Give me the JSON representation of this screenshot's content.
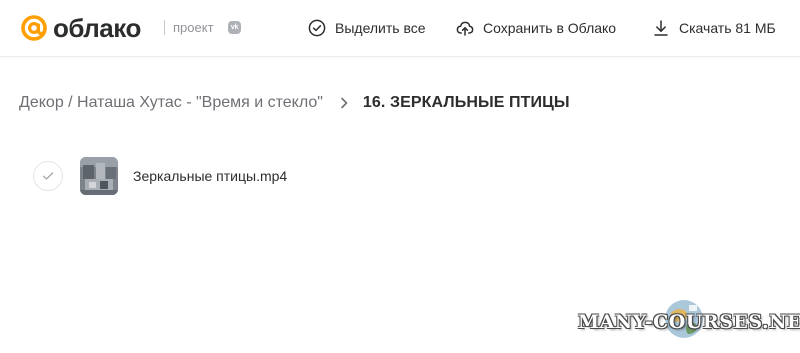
{
  "header": {
    "logo_text": "облако",
    "project_label": "проект",
    "vk_badge": "vk",
    "actions": {
      "select_all": {
        "label": "Выделить все",
        "icon": "check-circle-icon"
      },
      "save_to_cloud": {
        "label": "Сохранить в Облако",
        "icon": "cloud-upload-icon"
      },
      "download": {
        "label": "Скачать 81 МБ",
        "icon": "download-icon"
      }
    }
  },
  "breadcrumb": {
    "parent": "Декор / Наташа Хутас - \"Время и стекло\"",
    "separator_icon": "chevron-right-icon",
    "current": "16. ЗЕРКАЛЬНЫЕ ПТИЦЫ"
  },
  "files": [
    {
      "name": "Зеркальные птицы.mp4",
      "selected": false,
      "thumbnail": "video-thumbnail"
    }
  ],
  "watermark": {
    "text": "MANY-COURSES.NET"
  },
  "colors": {
    "brand_orange": "#ff9e00",
    "text_primary": "#2c2d2e",
    "text_secondary": "#6e7075",
    "muted": "#919399"
  }
}
